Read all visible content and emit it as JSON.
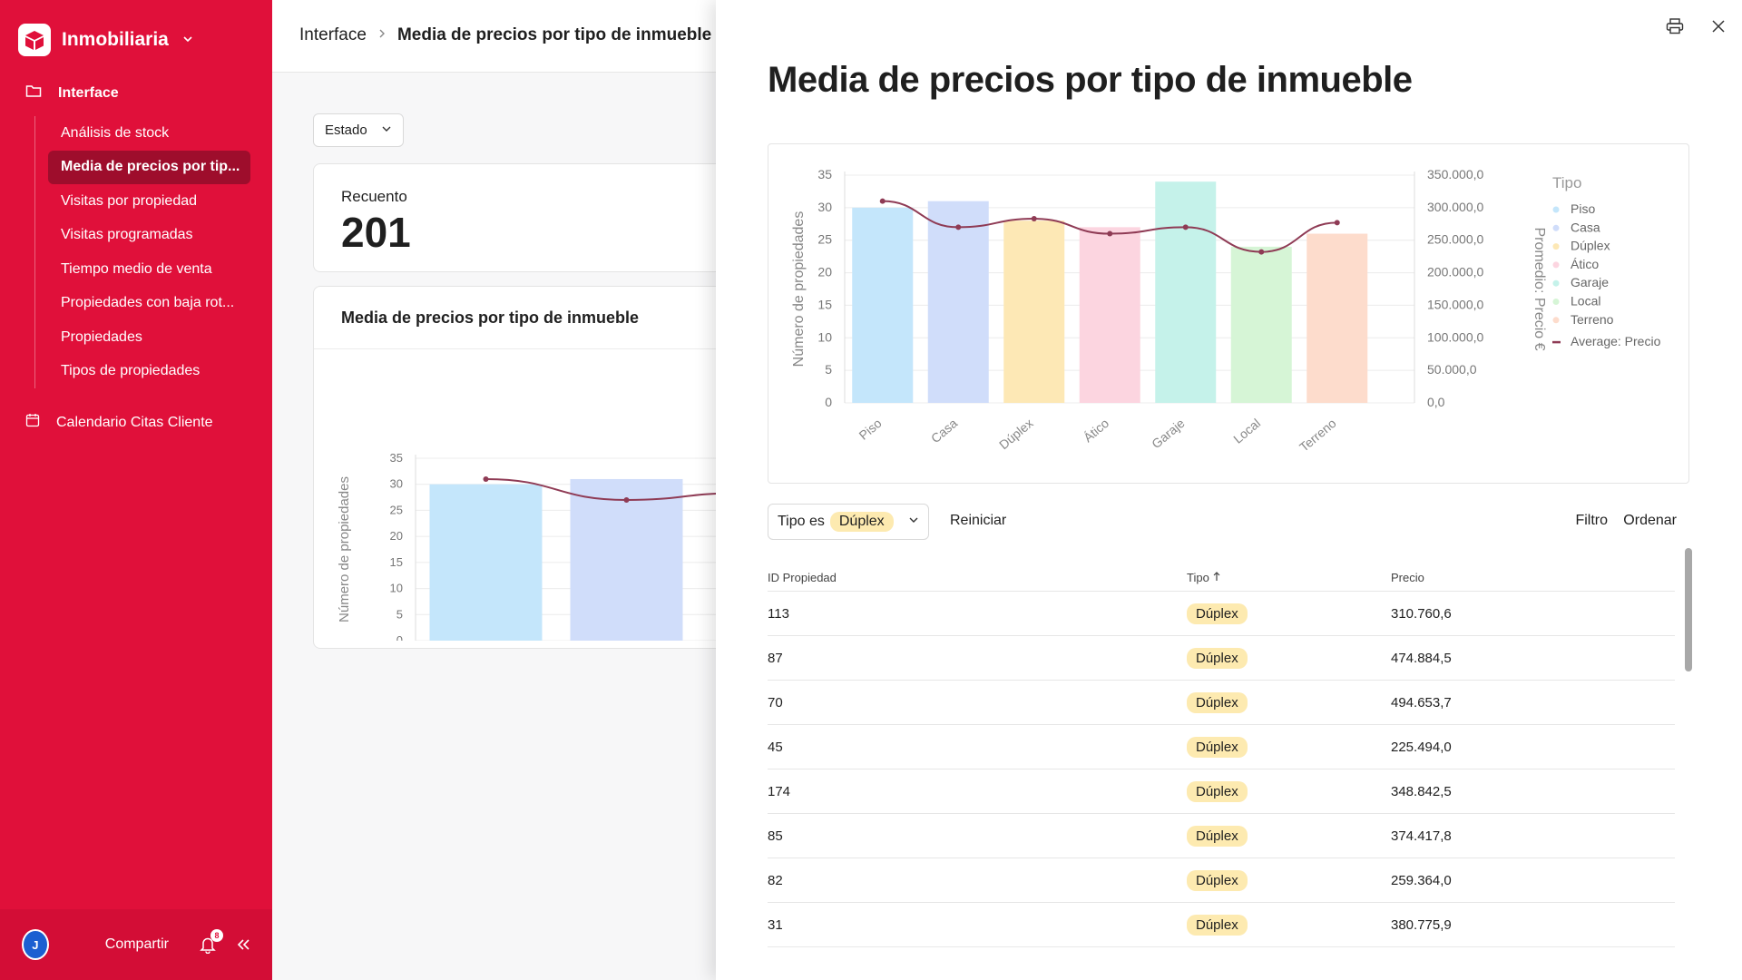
{
  "sidebar": {
    "brand": "Inmobiliaria",
    "section_label": "Interface",
    "items": [
      {
        "label": "Análisis de stock"
      },
      {
        "label": "Media de precios por tip..."
      },
      {
        "label": "Visitas por propiedad"
      },
      {
        "label": "Visitas programadas"
      },
      {
        "label": "Tiempo medio de venta"
      },
      {
        "label": "Propiedades con baja rot..."
      },
      {
        "label": "Propiedades"
      },
      {
        "label": "Tipos de propiedades"
      }
    ],
    "calendar_label": "Calendario Citas Cliente",
    "footer": {
      "avatar": "J",
      "share": "Compartir",
      "notifications": "8"
    }
  },
  "breadcrumb": {
    "root": "Interface",
    "current": "Media de precios por tipo de inmueble"
  },
  "filters": {
    "estado": "Estado"
  },
  "count_card": {
    "label": "Recuento",
    "value": "201"
  },
  "chart_card": {
    "title": "Media de precios por tipo de inmueble"
  },
  "panel": {
    "title": "Media de precios por tipo de inmueble",
    "filter_label": "Tipo es",
    "filter_value": "Dúplex",
    "reset": "Reiniciar",
    "filter": "Filtro",
    "order": "Ordenar"
  },
  "table": {
    "headers": [
      "ID Propiedad",
      "Tipo",
      "Precio"
    ],
    "rows": [
      {
        "id": "113",
        "tipo": "Dúplex",
        "precio": "310.760,6"
      },
      {
        "id": "87",
        "tipo": "Dúplex",
        "precio": "474.884,5"
      },
      {
        "id": "70",
        "tipo": "Dúplex",
        "precio": "494.653,7"
      },
      {
        "id": "45",
        "tipo": "Dúplex",
        "precio": "225.494,0"
      },
      {
        "id": "174",
        "tipo": "Dúplex",
        "precio": "348.842,5"
      },
      {
        "id": "85",
        "tipo": "Dúplex",
        "precio": "374.417,8"
      },
      {
        "id": "82",
        "tipo": "Dúplex",
        "precio": "259.364,0"
      },
      {
        "id": "31",
        "tipo": "Dúplex",
        "precio": "380.775,9"
      }
    ]
  },
  "chart_data": {
    "type": "bar",
    "categories": [
      "Piso",
      "Casa",
      "Dúplex",
      "Ático",
      "Garaje",
      "Local",
      "Terreno"
    ],
    "values": [
      30,
      31,
      28,
      27,
      34,
      24,
      26
    ],
    "line_values": [
      310000,
      270000,
      283000,
      260000,
      270000,
      232000,
      277000
    ],
    "colors": [
      "#c4e6fb",
      "#d0ddfa",
      "#fde8b5",
      "#fcd5e0",
      "#c5f2ea",
      "#d6f5d6",
      "#fddccc"
    ],
    "line_color": "#8f3b55",
    "ylabel": "Número de propiedades",
    "y2label": "Promedio: Precio €",
    "ylim": [
      0,
      35
    ],
    "yticks": [
      "0",
      "5",
      "10",
      "15",
      "20",
      "25",
      "30",
      "35"
    ],
    "y2ticks": [
      "0,0",
      "50.000,0",
      "100.000,0",
      "150.000,0",
      "200.000,0",
      "250.000,0",
      "300.000,0",
      "350.000,0"
    ],
    "y2lim": [
      0,
      350000
    ],
    "legend_title": "Tipo",
    "legend_line": "Average: Precio",
    "legend_placement": "right",
    "grid": true
  }
}
